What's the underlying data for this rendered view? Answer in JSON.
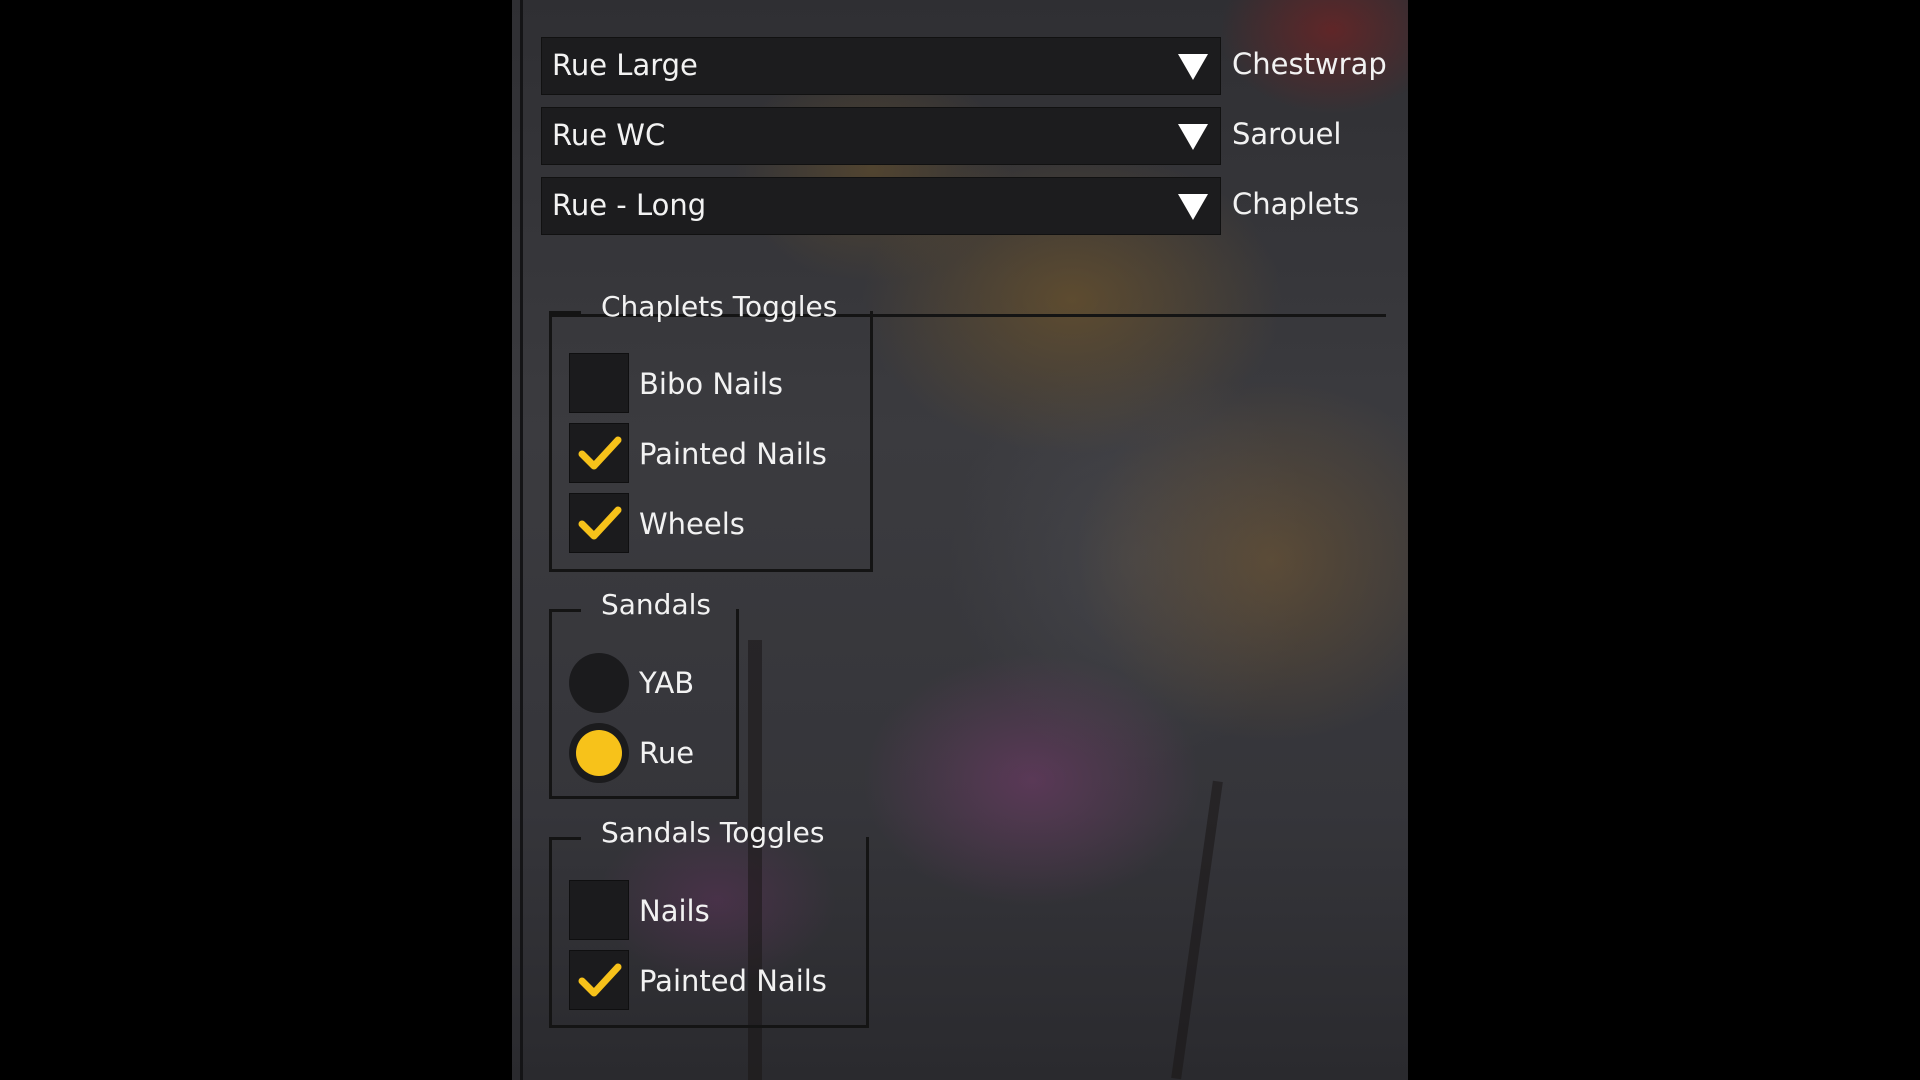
{
  "colors": {
    "accent": "#f7c21a",
    "control_bg": "#1c1c1e",
    "text": "#f2f2f2"
  },
  "dropdowns": [
    {
      "value": "Rue Large",
      "label": "Chestwrap"
    },
    {
      "value": "Rue WC",
      "label": "Sarouel"
    },
    {
      "value": "Rue - Long",
      "label": "Chaplets"
    }
  ],
  "chaplets_toggles": {
    "title": "Chaplets Toggles",
    "items": [
      {
        "label": "Bibo Nails",
        "checked": false
      },
      {
        "label": "Painted Nails",
        "checked": true
      },
      {
        "label": "Wheels",
        "checked": true
      }
    ]
  },
  "sandals": {
    "title": "Sandals",
    "options": [
      {
        "label": "YAB",
        "selected": false
      },
      {
        "label": "Rue",
        "selected": true
      }
    ]
  },
  "sandals_toggles": {
    "title": "Sandals Toggles",
    "items": [
      {
        "label": "Nails",
        "checked": false
      },
      {
        "label": "Painted Nails",
        "checked": true
      }
    ]
  }
}
